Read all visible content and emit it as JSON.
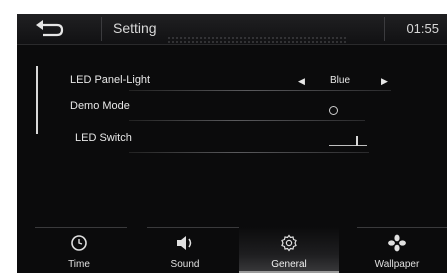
{
  "header": {
    "title": "Setting",
    "time": "01:55"
  },
  "settings": {
    "led_panel_light": {
      "label": "LED Panel-Light",
      "value": "Blue"
    },
    "demo_mode": {
      "label": "Demo Mode",
      "enabled": false
    },
    "led_switch": {
      "label": "LED Switch",
      "on": false
    }
  },
  "nav": {
    "items": [
      {
        "label": "Time",
        "icon": "clock-icon"
      },
      {
        "label": "Sound",
        "icon": "speaker-icon"
      },
      {
        "label": "General",
        "icon": "gear-icon",
        "active": true
      },
      {
        "label": "Wallpaper",
        "icon": "flower-icon"
      }
    ]
  },
  "colors": {
    "background": "#0b0b0c",
    "text": "#e8e8e8"
  }
}
